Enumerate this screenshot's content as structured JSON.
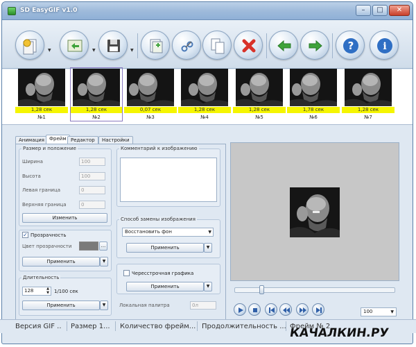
{
  "window": {
    "title": "SD EasyGIF v1.0",
    "min": "–",
    "max": "□",
    "close": "✕"
  },
  "toolbar": {
    "buttons": [
      {
        "name": "new-icon",
        "has_menu": true
      },
      {
        "name": "open-icon",
        "has_menu": true
      },
      {
        "name": "save-icon",
        "has_menu": true
      },
      {
        "name": "add-frame-icon",
        "has_menu": false
      },
      {
        "name": "cut-icon",
        "has_menu": false
      },
      {
        "name": "copy-icon",
        "has_menu": false
      },
      {
        "name": "delete-icon",
        "has_menu": false
      },
      {
        "name": "move-left-icon",
        "has_menu": false
      },
      {
        "name": "move-right-icon",
        "has_menu": false
      },
      {
        "name": "help-icon",
        "has_menu": false
      },
      {
        "name": "info-icon",
        "has_menu": false
      }
    ]
  },
  "frames": [
    {
      "duration": "1,28 сек",
      "label": "№1",
      "selected": false
    },
    {
      "duration": "1,28 сек",
      "label": "№2",
      "selected": true
    },
    {
      "duration": "0,07 сек",
      "label": "№3",
      "selected": false
    },
    {
      "duration": "1,28 сек",
      "label": "№4",
      "selected": false
    },
    {
      "duration": "1,28 сек",
      "label": "№5",
      "selected": false
    },
    {
      "duration": "1,78 сек",
      "label": "№6",
      "selected": false
    },
    {
      "duration": "1,28 сек",
      "label": "№7",
      "selected": false
    }
  ],
  "tabs": [
    "Анимация",
    "Фрейм",
    "Редактор",
    "Настройки"
  ],
  "active_tab": "Фрейм",
  "size_position": {
    "title": "Размер и положение",
    "width_label": "Ширина",
    "width_value": "100",
    "height_label": "Высота",
    "height_value": "100",
    "left_label": "Левая граница",
    "left_value": "0",
    "top_label": "Верхняя граница",
    "top_value": "0",
    "change_button": "Изменить"
  },
  "transparency": {
    "checkbox_label": "Прозрачность",
    "checked": true,
    "color_label": "Цвет прозрачности",
    "color": "#7a7a7a",
    "more_button": "...",
    "apply_button": "Применить"
  },
  "duration": {
    "title": "Длительность",
    "value": "128",
    "unit": "1/100 сек",
    "apply_button": "Применить"
  },
  "comment": {
    "title": "Комментарий к изображению",
    "value": ""
  },
  "replace_method": {
    "title": "Способ замены изображения",
    "selected": "Восстановить фон",
    "apply_button": "Применить"
  },
  "interlaced": {
    "checkbox_label": "Чересстрочная графика",
    "checked": false,
    "apply_button": "Применить"
  },
  "local_palette": {
    "label": "Локальная палитра",
    "value": "0л"
  },
  "player": {
    "zoom": "100",
    "position": 0.16
  },
  "status": {
    "items": [
      "Версия GIF ..",
      "Размер 1...",
      "Количество фрейм...",
      "Продолжительность ...",
      "Фрейм № 2"
    ]
  },
  "watermark": "КАЧАЛКИН.РУ",
  "colors": {
    "frame_duration_bg": "#f5f500",
    "window_bg": "#dfe8f2",
    "preview_bg": "#c7c7c7"
  }
}
